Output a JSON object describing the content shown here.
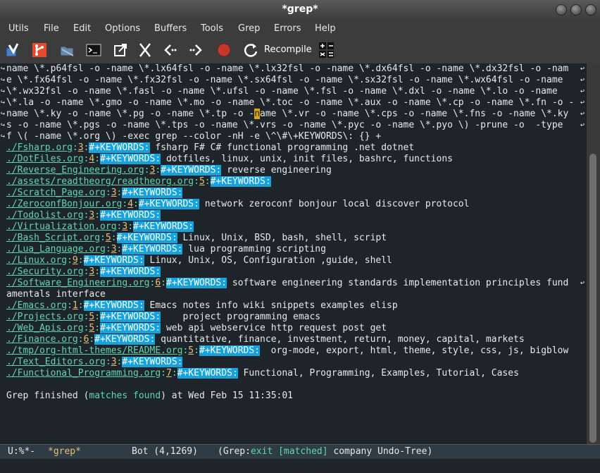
{
  "window": {
    "title": "*grep*"
  },
  "menubar": [
    "Utils",
    "File",
    "Edit",
    "Options",
    "Buffers",
    "Tools",
    "Grep",
    "Errors",
    "Help"
  ],
  "toolbar": {
    "icons": [
      "grep-tool-icon",
      "git-icon",
      "folder-icon",
      "terminal-icon",
      "external-link-icon",
      "cut-icon",
      "back-icon",
      "forward-icon",
      "stop-icon",
      "recompile-icon",
      "calculator-icon"
    ],
    "recompile_label": "Recompile"
  },
  "editor": {
    "cmd_lines": [
      "name \\*.p64fsl -o -name \\*.lx64fsl -o -name \\*.lx32fsl -o -name \\*.dx64fsl -o -name \\*.dx32fsl -o -nam",
      "e \\*.fx64fsl -o -name \\*.fx32fsl -o -name \\*.sx64fsl -o -name \\*.sx32fsl -o -name \\*.wx64fsl -o -name ",
      "\\*.wx32fsl -o -name \\*.fasl -o -name \\*.ufsl -o -name \\*.fsl -o -name \\*.dxl -o -name \\*.lo -o -name ",
      "\\*.la -o -name \\*.gmo -o -name \\*.mo -o -name \\*.toc -o -name \\*.aux -o -name \\*.cp -o -name \\*.fn -o -",
      [
        "name \\*.ky -o -name \\*.pg -o -name \\*.tp -o -",
        "n",
        "ame \\*.vr -o -name \\*.cps -o -name \\*.fns -o -name \\*.ky"
      ],
      "s -o -name \\*.pgs -o -name \\*.tps -o -name \\*.vrs -o -name \\*.pyc -o -name \\*.pyo \\) -prune -o  -type ",
      "f \\( -name \\*.org \\) -exec grep --color -nH -e \\^\\#\\+KEYWORDS\\: {} +"
    ],
    "results": [
      {
        "file": "./Fsharp.org",
        "line": "3",
        "kw": "#+KEYWORDS:",
        "text": " fsharp F# C# functional programming .net dotnet"
      },
      {
        "file": "./DotFiles.org",
        "line": "4",
        "kw": "#+KEYWORDS:",
        "text": " dotfiles, linux, unix, init files, bashrc, functions"
      },
      {
        "file": "./Reverse_Engineering.org",
        "line": "3",
        "kw": "#+KEYWORDS:",
        "text": " reverse engineering"
      },
      {
        "file": "./assets/readtheorg/readtheorg.org",
        "line": "5",
        "kw": "#+KEYWORDS:",
        "text": ""
      },
      {
        "file": "./Scratch_Page.org",
        "line": "3",
        "kw": "#+KEYWORDS:",
        "text": ""
      },
      {
        "file": "./ZeroconfBonjour.org",
        "line": "4",
        "kw": "#+KEYWORDS:",
        "text": " network zeroconf bonjour local discover protocol"
      },
      {
        "file": "./Todolist.org",
        "line": "3",
        "kw": "#+KEYWORDS:",
        "text": ""
      },
      {
        "file": "./Virtualization.org",
        "line": "3",
        "kw": "#+KEYWORDS:",
        "text": ""
      },
      {
        "file": "./Bash_Script.org",
        "line": "5",
        "kw": "#+KEYWORDS:",
        "text": " Linux, Unix, BSD, bash, shell, script"
      },
      {
        "file": "./Lua_Language.org",
        "line": "3",
        "kw": "#+KEYWORDS:",
        "text": " lua programming scripting"
      },
      {
        "file": "./Linux.org",
        "line": "9",
        "kw": "#+KEYWORDS:",
        "text": " Linux, Unix, OS, Configuration ,guide, shell"
      },
      {
        "file": "./Security.org",
        "line": "3",
        "kw": "#+KEYWORDS:",
        "text": ""
      },
      {
        "file": "./Software_Engineering.org",
        "line": "6",
        "kw": "#+KEYWORDS:",
        "text": " software engineering standards implementation principles fund",
        "wrap": "amentals interface"
      },
      {
        "file": "./Emacs.org",
        "line": "1",
        "kw": "#+KEYWORDS:",
        "text": " Emacs notes info wiki snippets examples elisp"
      },
      {
        "file": "./Projects.org",
        "line": "5",
        "kw": "#+KEYWORDS:",
        "text": "    project programming emacs"
      },
      {
        "file": "./Web_Apis.org",
        "line": "5",
        "kw": "#+KEYWORDS:",
        "text": " web api webservice http request post get"
      },
      {
        "file": "./Finance.org",
        "line": "6",
        "kw": "#+KEYWORDS:",
        "text": " quantitative, finance, investment, return, money, capital, markets"
      },
      {
        "file": "./tmp/org-html-themes/README.org",
        "line": "5",
        "kw": "#+KEYWORDS:",
        "text": "  org-mode, export, html, theme, style, css, js, bigblow"
      },
      {
        "file": "./Text_Editors.org",
        "line": "3",
        "kw": "#+KEYWORDS:",
        "text": ""
      },
      {
        "file": "./Functional_Programming.org",
        "line": "7",
        "kw": "#+KEYWORDS:",
        "text": " Functional, Programming, Examples, Tutorial, Cases"
      }
    ],
    "finished": {
      "prefix": "Grep finished (",
      "status": "matches found",
      "suffix": ") at Wed Feb 15 11:35:01"
    }
  },
  "modeline": {
    "state": "U:%*-",
    "buffer": "*grep*",
    "position": "Bot (4,1269)",
    "mode_open": "(Grep:",
    "exit": "exit",
    "matched": "[matched]",
    "rest": " company Undo-Tree)"
  },
  "colors": {
    "keyword_bg": "#14a3e0",
    "filename": "#5fd7af",
    "line_number": "#e5c07b",
    "buffer_name": "#e5c07b",
    "background": "#1d252b"
  }
}
